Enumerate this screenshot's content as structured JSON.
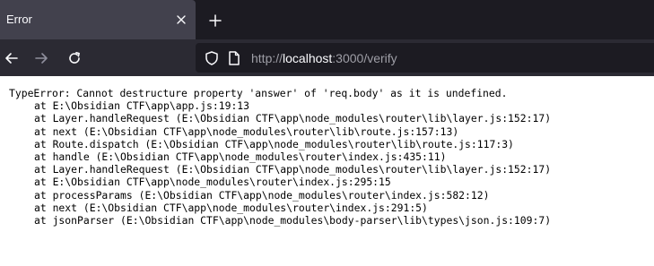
{
  "tab": {
    "title": "Error",
    "close_icon": "close-icon"
  },
  "toolbar": {
    "new_tab_icon": "plus-icon",
    "back_icon": "arrow-left-icon",
    "forward_icon": "arrow-right-icon",
    "reload_icon": "reload-icon"
  },
  "urlbar": {
    "scheme": "http://",
    "host": "localhost",
    "rest": ":3000/verify",
    "shield_icon": "shield-icon",
    "page_icon": "page-icon"
  },
  "error": {
    "message": "TypeError: Cannot destructure property 'answer' of 'req.body' as it is undefined.",
    "frames": [
      "at E:\\Obsidian CTF\\app\\app.js:19:13",
      "at Layer.handleRequest (E:\\Obsidian CTF\\app\\node_modules\\router\\lib\\layer.js:152:17)",
      "at next (E:\\Obsidian CTF\\app\\node_modules\\router\\lib\\route.js:157:13)",
      "at Route.dispatch (E:\\Obsidian CTF\\app\\node_modules\\router\\lib\\route.js:117:3)",
      "at handle (E:\\Obsidian CTF\\app\\node_modules\\router\\index.js:435:11)",
      "at Layer.handleRequest (E:\\Obsidian CTF\\app\\node_modules\\router\\lib\\layer.js:152:17)",
      "at E:\\Obsidian CTF\\app\\node_modules\\router\\index.js:295:15",
      "at processParams (E:\\Obsidian CTF\\app\\node_modules\\router\\index.js:582:12)",
      "at next (E:\\Obsidian CTF\\app\\node_modules\\router\\index.js:291:5)",
      "at jsonParser (E:\\Obsidian CTF\\app\\node_modules\\body-parser\\lib\\types\\json.js:109:7)"
    ]
  },
  "colors": {
    "tabstrip_bg": "#1c1b22",
    "active_tab_bg": "#42414d",
    "navbar_bg": "#2b2a33",
    "urlbar_bg": "#1c1b22",
    "url_dim": "#9e9ea6",
    "url_bright": "#fbfbfe"
  }
}
